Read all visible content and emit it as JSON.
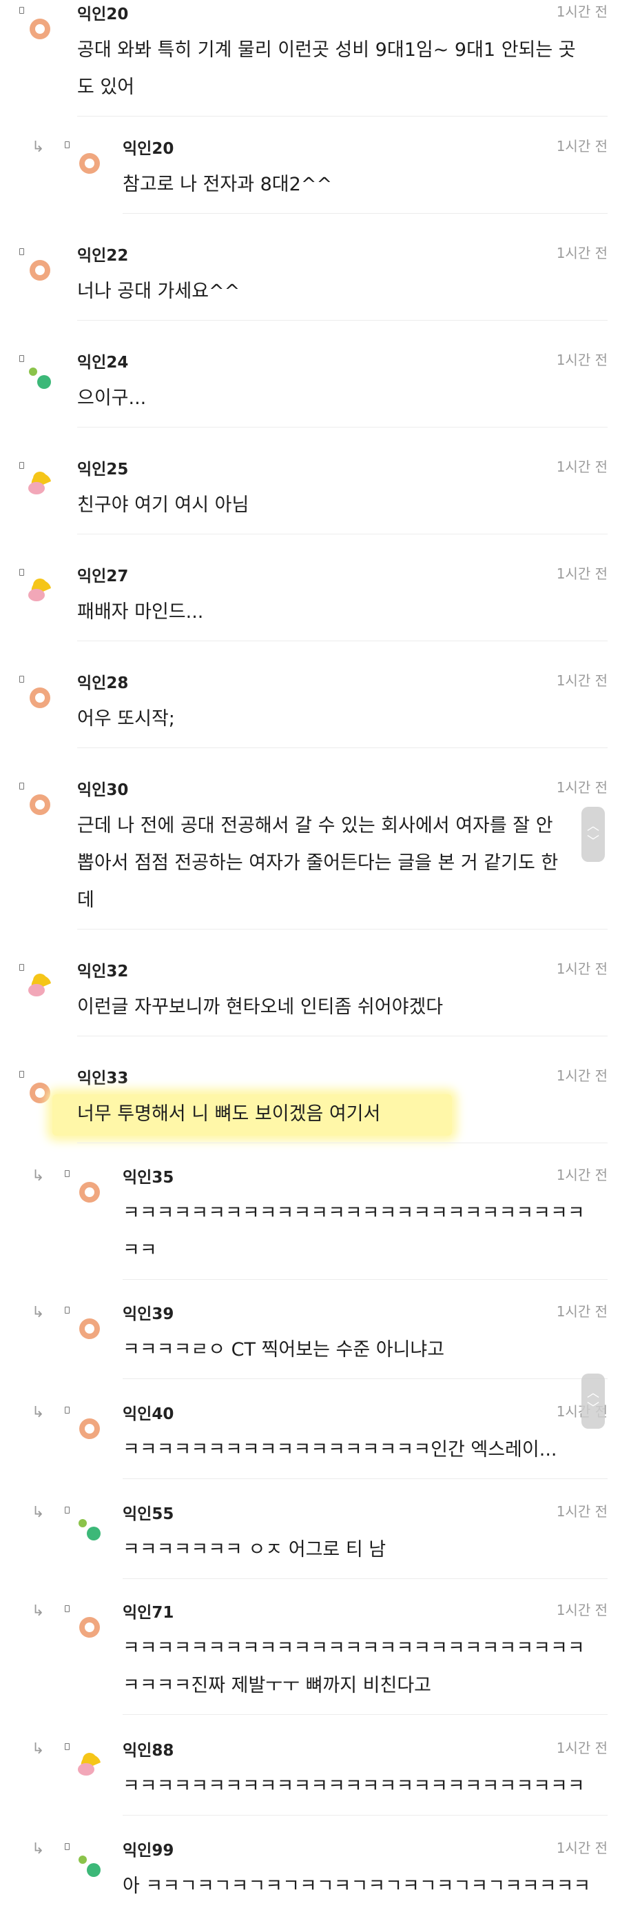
{
  "comments": [
    {
      "user": "익인20",
      "time": "1시간 전",
      "reply": false,
      "avatar": "orange",
      "lines": [
        "공대 와봐 특히 기계 물리 이런곳 성비 9대1임~ 9대1 안되는 곳",
        "도 있어"
      ]
    },
    {
      "user": "익인20",
      "time": "1시간 전",
      "reply": true,
      "avatar": "orange",
      "lines": [
        "참고로 나 전자과 8대2^^"
      ]
    },
    {
      "user": "익인22",
      "time": "1시간 전",
      "reply": false,
      "avatar": "orange",
      "lines": [
        "너나 공대 가세요^^"
      ]
    },
    {
      "user": "익인24",
      "time": "1시간 전",
      "reply": false,
      "avatar": "green",
      "lines": [
        "으이구..."
      ]
    },
    {
      "user": "익인25",
      "time": "1시간 전",
      "reply": false,
      "avatar": "yellowpink",
      "lines": [
        "친구야 여기 여시 아님"
      ]
    },
    {
      "user": "익인27",
      "time": "1시간 전",
      "reply": false,
      "avatar": "yellowpink",
      "lines": [
        "패배자 마인드..."
      ]
    },
    {
      "user": "익인28",
      "time": "1시간 전",
      "reply": false,
      "avatar": "orange",
      "lines": [
        "어우 또시작;"
      ]
    },
    {
      "user": "익인30",
      "time": "1시간 전",
      "reply": false,
      "avatar": "orange",
      "lines": [
        "근데 나 전에 공대 전공해서 갈 수 있는 회사에서 여자를 잘 안",
        "뽑아서 점점 전공하는 여자가 줄어든다는 글을 본 거 같기도 한",
        "데"
      ]
    },
    {
      "user": "익인32",
      "time": "1시간 전",
      "reply": false,
      "avatar": "yellowpink",
      "lines": [
        "이런글 자꾸보니까 현타오네 인티좀 쉬어야겠다"
      ]
    },
    {
      "user": "익인33",
      "time": "1시간 전",
      "reply": false,
      "avatar": "orange",
      "highlight": true,
      "lines": [
        "너무 투명해서 니 뼈도 보이겠음 여기서"
      ]
    },
    {
      "user": "익인35",
      "time": "1시간 전",
      "reply": true,
      "avatar": "orange",
      "lines": [
        "ㅋㅋㅋㅋㅋㅋㅋㅋㅋㅋㅋㅋㅋㅋㅋㅋㅋㅋㅋㅋㅋㅋㅋㅋㅋㅋㅋ",
        "ㅋㅋ"
      ]
    },
    {
      "user": "익인39",
      "time": "1시간 전",
      "reply": true,
      "avatar": "orange",
      "lines": [
        "ㅋㅋㅋㅋㄹㅇ CT 찍어보는 수준 아니냐고"
      ]
    },
    {
      "user": "익인40",
      "time": "1시간 전",
      "reply": true,
      "avatar": "orange",
      "lines": [
        "ㅋㅋㅋㅋㅋㅋㅋㅋㅋㅋㅋㅋㅋㅋㅋㅋㅋㅋ인간 엑스레이..."
      ]
    },
    {
      "user": "익인55",
      "time": "1시간 전",
      "reply": true,
      "avatar": "green",
      "lines": [
        "ㅋㅋㅋㅋㅋㅋㅋ ㅇㅈ 어그로 티 남"
      ]
    },
    {
      "user": "익인71",
      "time": "1시간 전",
      "reply": true,
      "avatar": "orange",
      "lines": [
        "ㅋㅋㅋㅋㅋㅋㅋㅋㅋㅋㅋㅋㅋㅋㅋㅋㅋㅋㅋㅋㅋㅋㅋㅋㅋㅋㅋ",
        "ㅋㅋㅋㅋ진짜 제발ㅜㅜ 뼈까지 비친다고"
      ]
    },
    {
      "user": "익인88",
      "time": "1시간 전",
      "reply": true,
      "avatar": "yellowpink",
      "lines": [
        "ㅋㅋㅋㅋㅋㅋㅋㅋㅋㅋㅋㅋㅋㅋㅋㅋㅋㅋㅋㅋㅋㅋㅋㅋㅋㅋㅋ"
      ]
    },
    {
      "user": "익인99",
      "time": "1시간 전",
      "reply": true,
      "avatar": "green",
      "lines": [
        "아 ㅋㅋㄱㅋㄱㅋㄱㅋㄱㅋㄱㅋㄱㅋㄱㅋㄱㅋㄱㅋㄱㅋㅋㅋㅋㅋ"
      ]
    }
  ],
  "icons": {
    "reply": "reply-arrow-icon",
    "scroll": "scroll-handle-icon"
  },
  "colors": {
    "orange": "#f0a77f",
    "green": "#3cb878",
    "lightgreen": "#8bc34a",
    "yellow": "#f5c518",
    "pink": "#f2a7b8",
    "highlight": "#fff7a8"
  }
}
